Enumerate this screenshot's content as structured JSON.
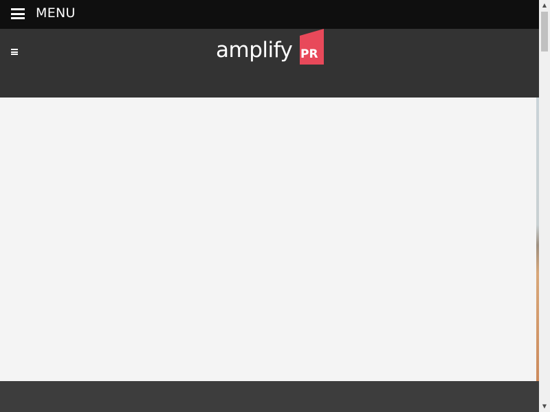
{
  "top_bar": {
    "menu_label": "MENU"
  },
  "header": {
    "logo": {
      "wordmark": "amplify",
      "badge": "PR",
      "badge_color": "#e8495a"
    }
  },
  "colors": {
    "top_bar_bg": "#0f0f0f",
    "header_bg": "#333333",
    "hero_bg": "#f4f4f4",
    "footer_bg": "#3d3d3d"
  },
  "icons": {
    "menu": "hamburger-icon",
    "nav_toggle": "small-hamburger-icon",
    "scroll_up": "triangle-up",
    "scroll_down": "triangle-down"
  }
}
